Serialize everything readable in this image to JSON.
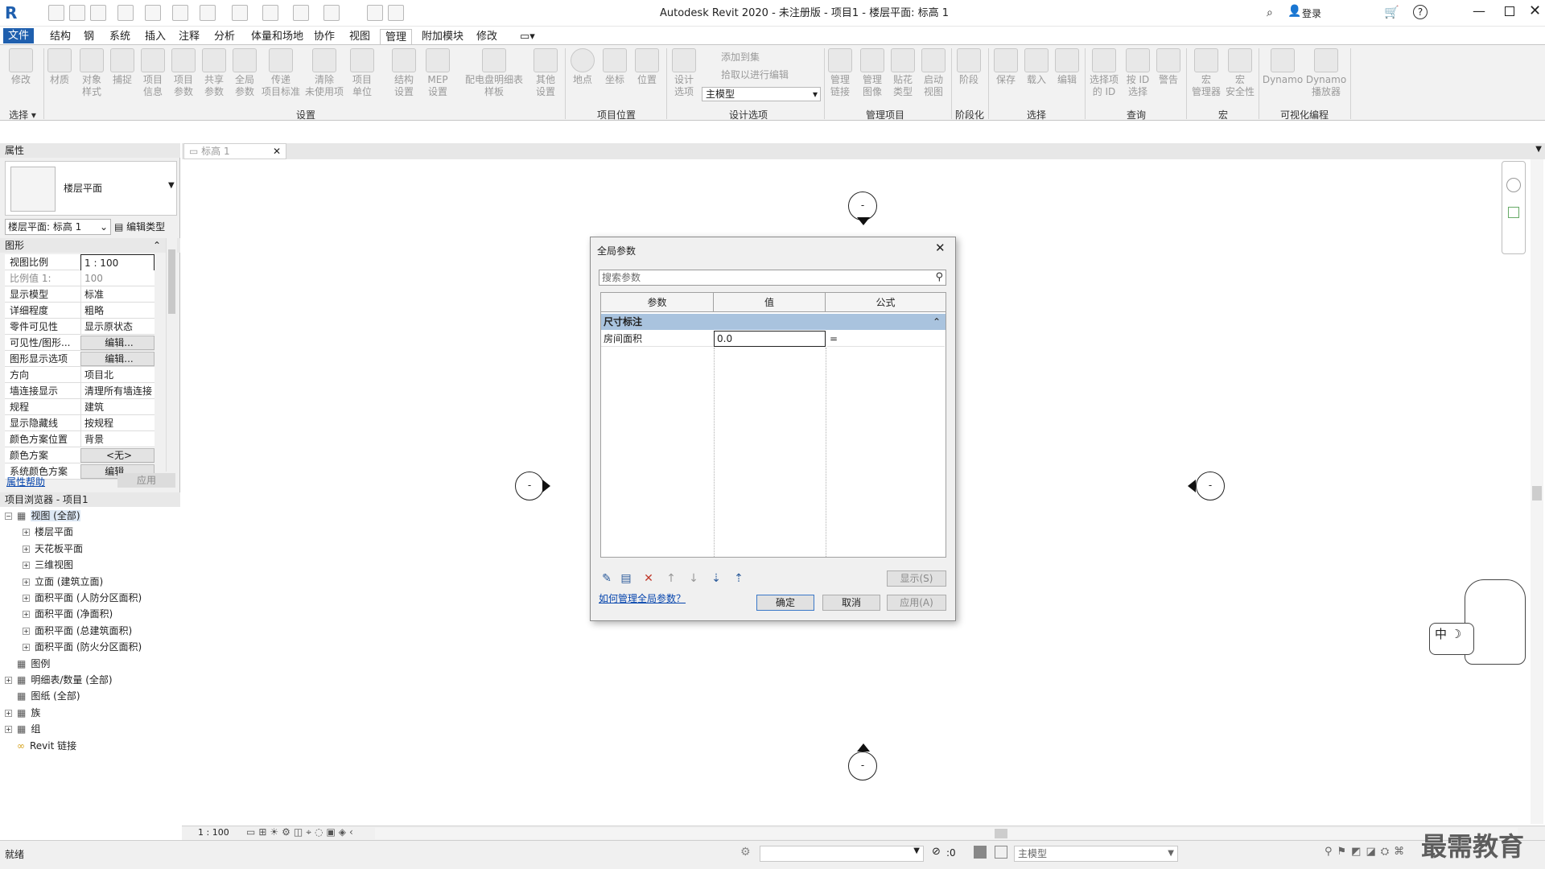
{
  "window": {
    "title": "Autodesk Revit 2020 - 未注册版 - 项目1 - 楼层平面: 标高 1",
    "login": "登录"
  },
  "tabs": [
    "文件",
    "结构",
    "钢",
    "系统",
    "插入",
    "注释",
    "分析",
    "体量和场地",
    "协作",
    "视图",
    "管理",
    "附加模块",
    "修改"
  ],
  "active_tab": "管理",
  "ribbon": {
    "buttons": [
      {
        "label": "修改"
      },
      {
        "label": "材质"
      },
      {
        "label": "对象\n样式"
      },
      {
        "label": "捕捉"
      },
      {
        "label": "项目\n信息"
      },
      {
        "label": "项目\n参数"
      },
      {
        "label": "共享\n参数"
      },
      {
        "label": "全局\n参数"
      },
      {
        "label": "传递\n项目标准"
      },
      {
        "label": "清除\n未使用项"
      },
      {
        "label": "项目\n单位"
      },
      {
        "label": "结构\n设置"
      },
      {
        "label": "MEP\n设置"
      },
      {
        "label": "配电盘明细表\n样板"
      },
      {
        "label": "其他\n设置"
      },
      {
        "label": "地点"
      },
      {
        "label": "坐标"
      },
      {
        "label": "位置"
      },
      {
        "label": "设计\n选项"
      },
      {
        "label": "管理\n链接"
      },
      {
        "label": "管理\n图像"
      },
      {
        "label": "贴花\n类型"
      },
      {
        "label": "启动\n视图"
      },
      {
        "label": "阶段"
      },
      {
        "label": "保存"
      },
      {
        "label": "载入"
      },
      {
        "label": "编辑"
      },
      {
        "label": "选择项\n的 ID"
      },
      {
        "label": "按 ID\n选择"
      },
      {
        "label": "警告"
      },
      {
        "label": "宏\n管理器"
      },
      {
        "label": "宏\n安全性"
      },
      {
        "label": "Dynamo"
      },
      {
        "label": "Dynamo\n播放器"
      }
    ],
    "small": {
      "add_to_set": "添加到集",
      "pick_to_edit": "拾取以进行编辑",
      "main_model": "主模型"
    },
    "groups": [
      "选择",
      "设置",
      "项目位置",
      "设计选项",
      "管理项目",
      "阶段化",
      "选择",
      "查询",
      "宏",
      "可视化编程"
    ]
  },
  "view_tab": "标高 1",
  "properties": {
    "header": "属性",
    "type_name": "楼层平面",
    "selector": "楼层平面: 标高 1",
    "edit_type": "编辑类型",
    "section": "图形",
    "rows": [
      {
        "k": "视图比例",
        "v": "1 : 100"
      },
      {
        "k": "比例值 1:",
        "v": "100"
      },
      {
        "k": "显示模型",
        "v": "标准"
      },
      {
        "k": "详细程度",
        "v": "粗略"
      },
      {
        "k": "零件可见性",
        "v": "显示原状态"
      },
      {
        "k": "可见性/图形...",
        "v": "编辑..."
      },
      {
        "k": "图形显示选项",
        "v": "编辑..."
      },
      {
        "k": "方向",
        "v": "项目北"
      },
      {
        "k": "墙连接显示",
        "v": "清理所有墙连接"
      },
      {
        "k": "规程",
        "v": "建筑"
      },
      {
        "k": "显示隐藏线",
        "v": "按规程"
      },
      {
        "k": "颜色方案位置",
        "v": "背景"
      },
      {
        "k": "颜色方案",
        "v": "<无>"
      },
      {
        "k": "系统颜色方案",
        "v": "编辑..."
      }
    ],
    "help": "属性帮助",
    "apply": "应用"
  },
  "browser": {
    "header": "项目浏览器 - 项目1",
    "items": [
      {
        "label": "视图 (全部)",
        "level": 0
      },
      {
        "label": "楼层平面",
        "level": 1
      },
      {
        "label": "天花板平面",
        "level": 1
      },
      {
        "label": "三维视图",
        "level": 1
      },
      {
        "label": "立面 (建筑立面)",
        "level": 1
      },
      {
        "label": "面积平面 (人防分区面积)",
        "level": 1
      },
      {
        "label": "面积平面 (净面积)",
        "level": 1
      },
      {
        "label": "面积平面 (总建筑面积)",
        "level": 1
      },
      {
        "label": "面积平面 (防火分区面积)",
        "level": 1
      },
      {
        "label": "图例",
        "level": 0
      },
      {
        "label": "明细表/数量 (全部)",
        "level": 0
      },
      {
        "label": "图纸 (全部)",
        "level": 0
      },
      {
        "label": "族",
        "level": 0
      },
      {
        "label": "组",
        "level": 0
      },
      {
        "label": "Revit 链接",
        "level": 0
      }
    ]
  },
  "dialog": {
    "title": "全局参数",
    "search_placeholder": "搜索参数",
    "columns": [
      "参数",
      "值",
      "公式"
    ],
    "group": "尺寸标注",
    "param": {
      "name": "房间面积",
      "value": "0.0",
      "formula": "="
    },
    "show_btn": "显示(S)",
    "help_link": "如何管理全局参数？",
    "ok": "确定",
    "cancel": "取消",
    "apply": "应用(A)"
  },
  "viewctrl": {
    "scale": "1 : 100"
  },
  "status": {
    "ready": "就绪",
    "count": ":0",
    "model": "主模型"
  },
  "watermark": "最需教育",
  "ime": "中"
}
